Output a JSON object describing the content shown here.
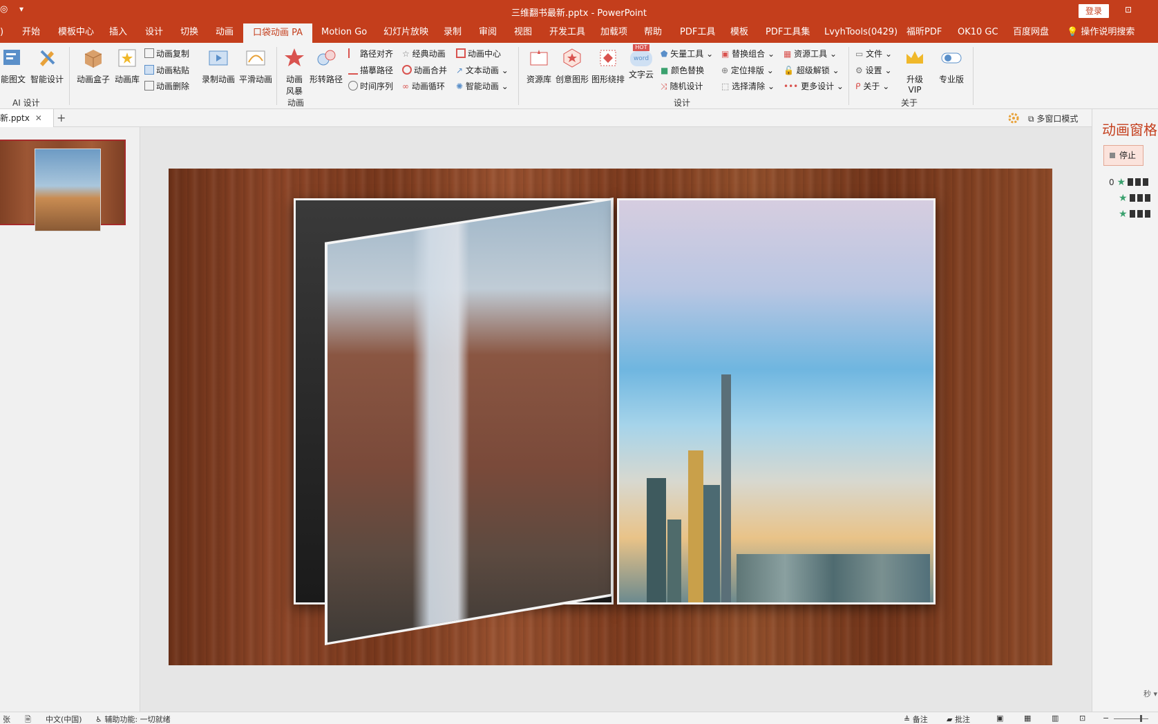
{
  "titlebar": {
    "quick_access": "◎",
    "customize": "▾",
    "doc_title": "三维翻书最新.pptx  -  PowerPoint",
    "login": "登录",
    "restore": "⊡"
  },
  "tabs": [
    "开始",
    "模板中心",
    "插入",
    "设计",
    "切换",
    "动画",
    "口袋动画 PA",
    "Motion Go",
    "幻灯片放映",
    "录制",
    "审阅",
    "视图",
    "开发工具",
    "加载项",
    "帮助",
    "PDF工具",
    "模板",
    "PDF工具集",
    "LvyhTools(0429)",
    "福昕PDF",
    "OK10 GC",
    "百度网盘",
    "操作说明搜索"
  ],
  "tab_left_fragment": ")",
  "ribbon": {
    "ai_group": {
      "btn1": "能图文",
      "btn2": "智能设计",
      "label": "AI 设计"
    },
    "box_group": {
      "btn1": "动画盒子",
      "btn2": "动画库",
      "small1": "动画复制",
      "small2": "动画粘贴",
      "small3": "动画删除"
    },
    "record_group": {
      "btn1": "录制动画",
      "btn2": "平滑动画"
    },
    "anim_group": {
      "btn1a": "动画",
      "btn1b": "风暴",
      "btn2": "形转路径",
      "s1": "路径对齐",
      "s2": "描摹路径",
      "s3": "时间序列",
      "s4": "经典动画",
      "s5": "动画合并",
      "s6": "动画循环",
      "s7": "动画中心",
      "s8": "文本动画",
      "s9": "智能动画",
      "label": "动画"
    },
    "design_group": {
      "btn1": "资源库",
      "btn2": "创意图形",
      "btn3": "图形绕排",
      "btn4": "文字云",
      "hot_badge": "HOT",
      "word_badge": "word",
      "s1": "矢量工具",
      "s2": "颜色替换",
      "s3": "随机设计",
      "s4": "替换组合",
      "s5": "定位排版",
      "s6": "选择清除",
      "s7": "资源工具",
      "s8": "超级解锁",
      "s9": "更多设计",
      "label": "设计"
    },
    "about_group": {
      "s1": "文件",
      "s2": "设置",
      "s3": "关于",
      "vip1": "升级",
      "vip2": "VIP",
      "pro": "专业版",
      "label": "关于"
    }
  },
  "filestrip": {
    "file_name": "新.pptx",
    "close": "✕",
    "more": "⋮",
    "add": "+",
    "multiwin": "多窗口模式"
  },
  "animpane": {
    "title": "动画窗格",
    "stop": "停止",
    "row1_num": "0",
    "seconds": "秒 ▾"
  },
  "statusbar": {
    "slide_count": "张",
    "lang": "中文(中国)",
    "accessibility": "辅助功能: 一切就绪",
    "notes": "备注",
    "comments": "批注"
  },
  "colors": {
    "accent": "#c43e1c",
    "star": "#3aa16e"
  }
}
